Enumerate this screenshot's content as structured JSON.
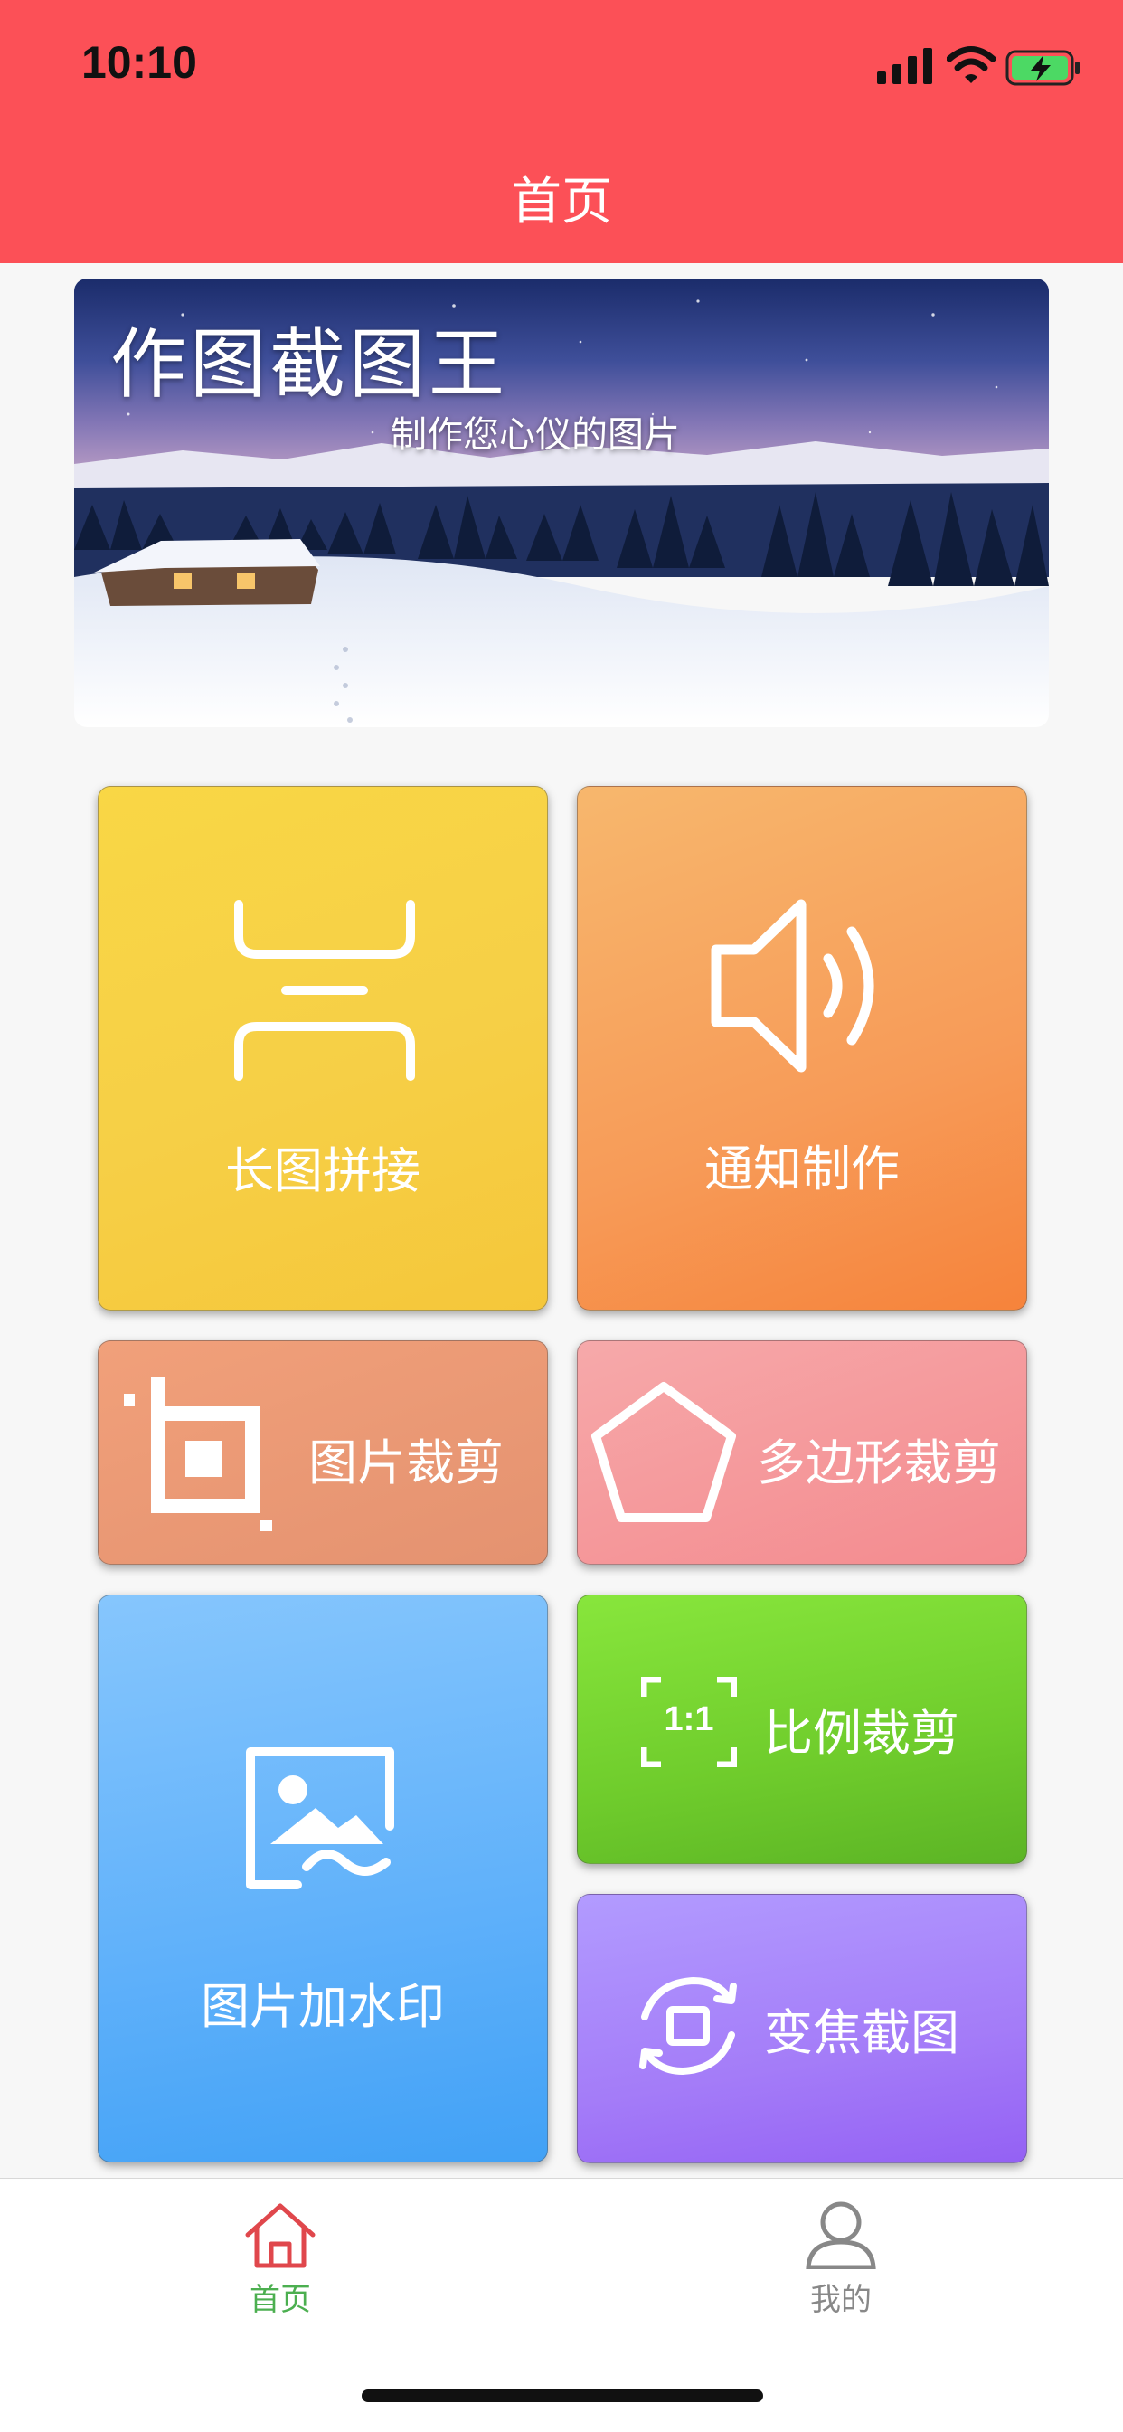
{
  "status_bar": {
    "time": "10:10"
  },
  "header": {
    "title": "首页"
  },
  "banner": {
    "title": "作图截图王",
    "subtitle": "制作您心仪的图片"
  },
  "tiles": [
    {
      "label": "长图拼接",
      "icon": "long-image-stitch-icon"
    },
    {
      "label": "通知制作",
      "icon": "speaker-icon"
    },
    {
      "label": "图片裁剪",
      "icon": "crop-icon"
    },
    {
      "label": "多边形裁剪",
      "icon": "pentagon-icon"
    },
    {
      "label": "图片加水印",
      "icon": "image-watermark-icon"
    },
    {
      "label": "比例裁剪",
      "icon": "ratio-1-1-icon",
      "icon_text": "1:1"
    },
    {
      "label": "变焦截图",
      "icon": "zoom-rotate-icon"
    }
  ],
  "tabbar": {
    "items": [
      {
        "label": "首页",
        "icon": "home-icon",
        "active": true
      },
      {
        "label": "我的",
        "icon": "user-icon",
        "active": false
      }
    ]
  },
  "colors": {
    "header_bg": "#fc5057",
    "tab_active": "#4caf50",
    "tab_active_icon": "#e0474c",
    "tab_inactive": "#888888"
  }
}
